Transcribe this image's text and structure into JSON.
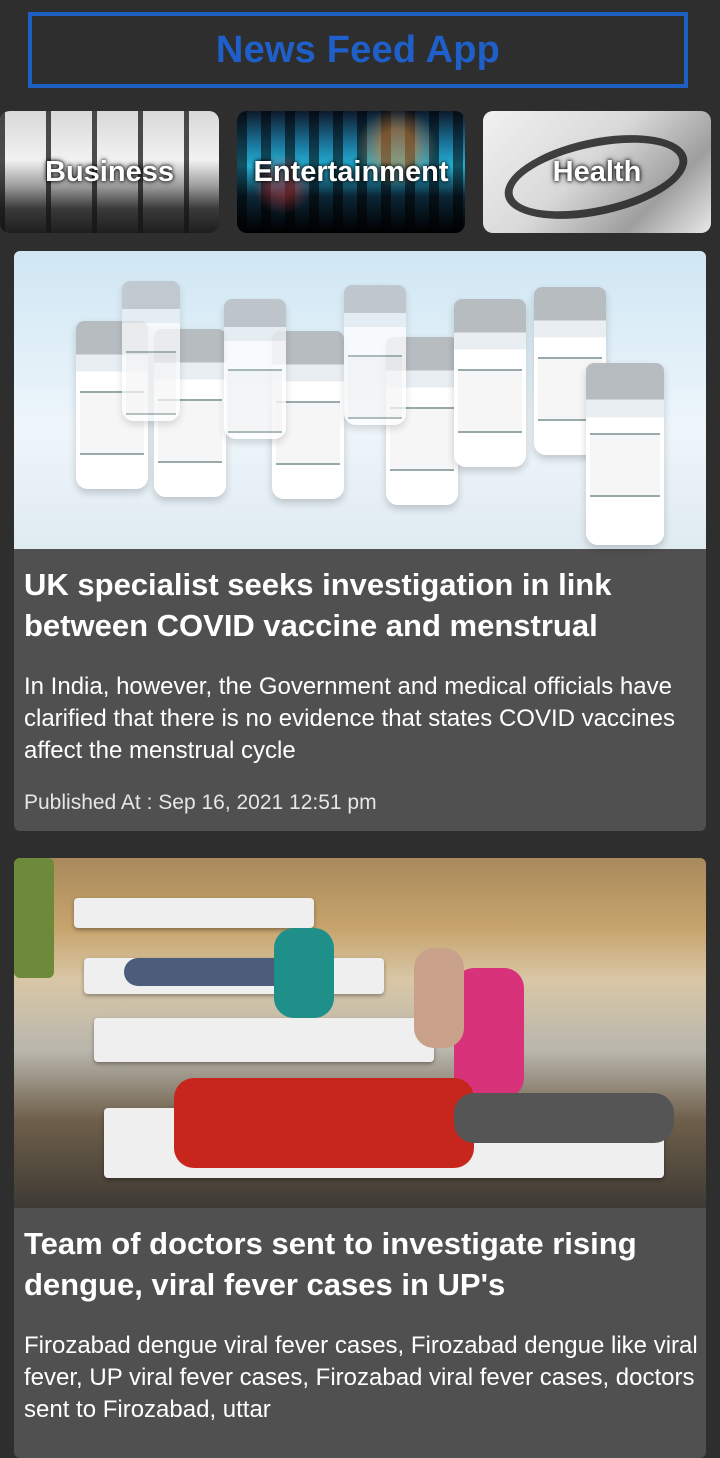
{
  "app": {
    "title": "News Feed App"
  },
  "categories": [
    {
      "label": "Business"
    },
    {
      "label": "Entertainment"
    },
    {
      "label": "Health"
    }
  ],
  "articles": [
    {
      "title": "UK specialist seeks investigation in link between COVID vaccine and menstrual",
      "description": "In India, however, the Government and medical officials have clarified that there is no evidence that states COVID vaccines affect the menstrual cycle",
      "published": "Published At : Sep 16, 2021 12:51 pm"
    },
    {
      "title": "Team of doctors sent to investigate rising dengue, viral fever cases in UP's",
      "description": "Firozabad dengue viral fever cases, Firozabad dengue like viral fever, UP viral fever cases, Firozabad viral fever cases, doctors sent to Firozabad,  uttar"
    }
  ]
}
